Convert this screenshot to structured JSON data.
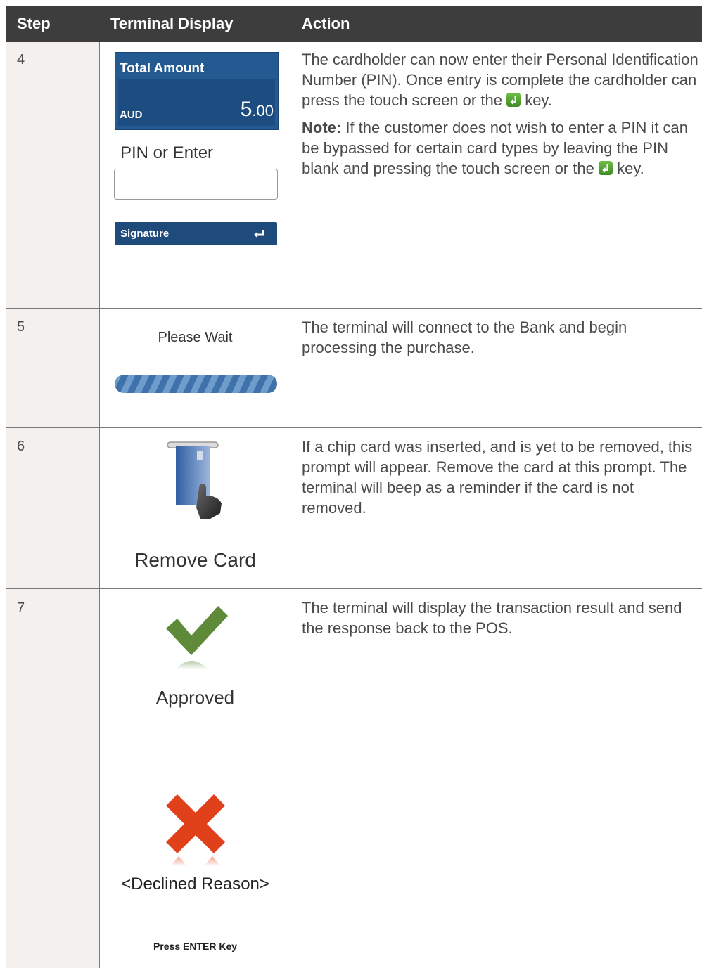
{
  "header": {
    "col_step": "Step",
    "col_display": "Terminal Display",
    "col_action": "Action"
  },
  "rows": [
    {
      "step": "4",
      "display": {
        "total_label": "Total Amount",
        "currency": "AUD",
        "amount_main": "5",
        "amount_cents": ".00",
        "pin_prompt": "PIN or Enter",
        "pin_value": "",
        "signature_label": "Signature",
        "signature_icon": "enter-arrow-icon"
      },
      "action_p1_before_key": "The cardholder can now enter their Personal Identification Number (PIN). Once entry is complete the cardholder can press the touch screen or the",
      "action_p1_after_key": "key.",
      "action_note_label": "Note:",
      "action_p2_before_key": "If the customer does not wish to enter a PIN it can be bypassed for certain card types by leaving the PIN blank and pressing the touch screen or the",
      "action_p2_after_key": "key."
    },
    {
      "step": "5",
      "display": {
        "wait_label": "Please Wait"
      },
      "action": "The terminal will connect to the Bank and begin processing the purchase."
    },
    {
      "step": "6",
      "display": {
        "remove_label": "Remove Card",
        "icon": "remove-card-icon"
      },
      "action": "If a chip card was inserted, and is yet to be removed, this prompt will appear. Remove the card at this prompt. The terminal will beep as a reminder if the card is not removed."
    },
    {
      "step": "7",
      "display": {
        "approved_label": "Approved",
        "approved_icon": "checkmark-icon",
        "declined_label": "<Declined Reason>",
        "declined_icon": "cross-icon",
        "press_enter_label": "Press ENTER Key"
      },
      "action": "The terminal will display the transaction result and send the response back to the POS."
    }
  ],
  "colors": {
    "header_bg": "#3d3d3d",
    "step_col_bg": "#f3f0ee",
    "terminal_blue": "#235a92",
    "approved_green": "#5f8a3a",
    "declined_red": "#e0411b"
  }
}
